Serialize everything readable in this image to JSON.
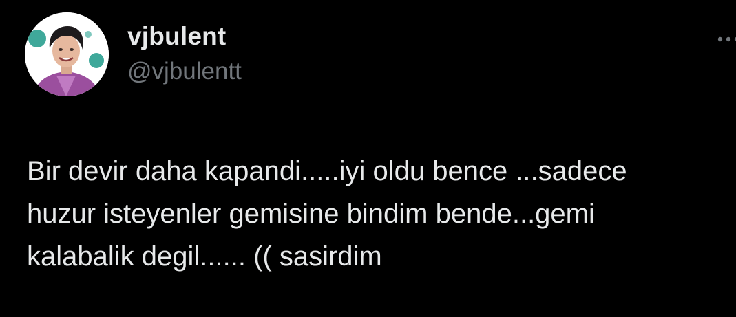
{
  "tweet": {
    "author": {
      "display_name": "vjbulent",
      "handle": "@vjbulentt",
      "avatar_icon": "profile-photo"
    },
    "more_icon": "more-options-icon",
    "text_lines": [
      "Bir devir daha kapandi.....iyi oldu bence ...sadece",
      "huzur isteyenler gemisine bindim bende...gemi",
      "kalabalik degil...... (( sasirdim"
    ]
  },
  "colors": {
    "background": "#000000",
    "primary_text": "#e7e9ea",
    "secondary_text": "#71767b",
    "avatar_accent_teal": "#3fa89a",
    "avatar_accent_purple": "#9b4f9e"
  }
}
